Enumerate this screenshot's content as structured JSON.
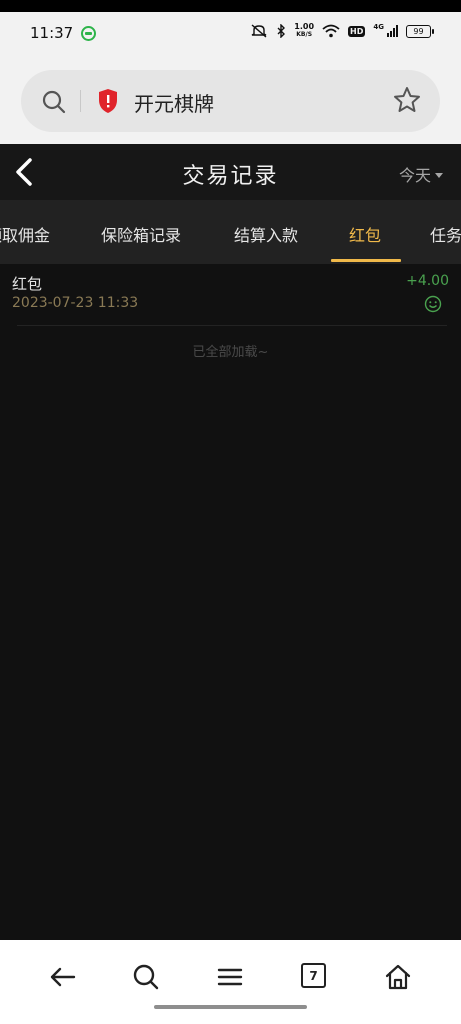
{
  "status_bar": {
    "time": "11:37",
    "net_speed_value": "1.00",
    "net_speed_unit": "KB/S",
    "hd_label": "HD",
    "network_gen": "4G",
    "battery": "99"
  },
  "browser": {
    "url_title": "开元棋牌",
    "tab_count": "7"
  },
  "header": {
    "title": "交易记录",
    "date_filter": "今天"
  },
  "tabs": [
    {
      "label": "领取佣金",
      "active": false
    },
    {
      "label": "保险箱记录",
      "active": false
    },
    {
      "label": "结算入款",
      "active": false
    },
    {
      "label": "红包",
      "active": true
    },
    {
      "label": "任务",
      "active": false
    }
  ],
  "records": [
    {
      "title": "红包",
      "time": "2023-07-23 11:33",
      "amount": "+4.00"
    }
  ],
  "list_end_text": "已全部加载~",
  "colors": {
    "accent": "#f0b94a",
    "amount_positive": "#4aa24f",
    "background": "#111111"
  }
}
